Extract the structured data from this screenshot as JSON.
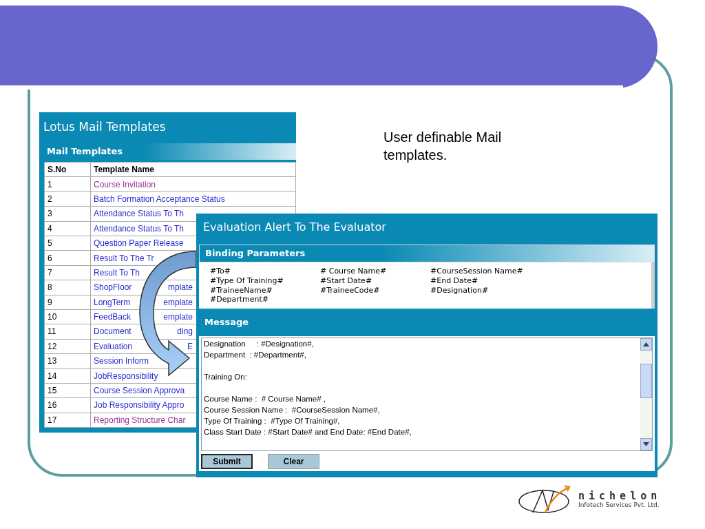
{
  "slide_note": "User definable Mail templates.",
  "templates_panel": {
    "title": "Lotus Mail Templates",
    "section": "Mail Templates",
    "columns": [
      "S.No",
      "Template Name"
    ],
    "rows": [
      {
        "sno": "1",
        "name": "Course Invitation",
        "visited": true
      },
      {
        "sno": "2",
        "name": "Batch Formation Acceptance Status",
        "visited": false
      },
      {
        "sno": "3",
        "name": "Attendance Status To Th",
        "visited": false
      },
      {
        "sno": "4",
        "name": "Attendance Status To Th",
        "visited": false
      },
      {
        "sno": "5",
        "name": "Question Paper Release",
        "visited": false
      },
      {
        "sno": "6",
        "name": "Result To The Tr",
        "visited": false
      },
      {
        "sno": "7",
        "name": "Result To Th",
        "visited": false
      },
      {
        "sno": "8",
        "name": "ShopFloor",
        "tail": "mplate",
        "visited": false
      },
      {
        "sno": "9",
        "name": "LongTerm",
        "tail": "emplate",
        "visited": false
      },
      {
        "sno": "10",
        "name": "FeedBack",
        "tail": "emplate",
        "visited": false
      },
      {
        "sno": "11",
        "name": "Document",
        "tail": "ding",
        "visited": false
      },
      {
        "sno": "12",
        "name": "Evaluation",
        "tail": "E",
        "visited": false
      },
      {
        "sno": "13",
        "name": "Session Inform",
        "visited": false
      },
      {
        "sno": "14",
        "name": "JobResponsibility",
        "visited": false
      },
      {
        "sno": "15",
        "name": "Course Session Approva",
        "visited": false
      },
      {
        "sno": "16",
        "name": "Job Responsibility Appro",
        "visited": false
      },
      {
        "sno": "17",
        "name": "Reporting Structure Char",
        "visited": true
      }
    ]
  },
  "editor_window": {
    "title": "Evaluation Alert To The Evaluator",
    "binding_header": "Binding Parameters",
    "parameters": [
      "#To#",
      "# Course Name#",
      "#CourseSession Name#",
      "#Type Of Training#",
      "#Start Date#",
      "#End Date#",
      "#TraineeName#",
      "#TraineeCode#",
      "#Designation#",
      "#Department#"
    ],
    "message_header": "Message",
    "message": "Designation     : #Designation#,\nDepartment  : #Department#,\n\nTraining On:\n\nCourse Name :  # Course Name# ,\nCourse Session Name :  #CourseSession Name#,\nType Of Training :  #Type Of Training#,\nClass Start Date : #Start Date# and End Date: #End Date#,",
    "buttons": [
      {
        "label": "Submit",
        "focused": true
      },
      {
        "label": "Clear",
        "focused": false
      }
    ]
  },
  "logo": {
    "name": "nichelon",
    "subtitle": "Infotech Services Pvt. Ltd."
  }
}
